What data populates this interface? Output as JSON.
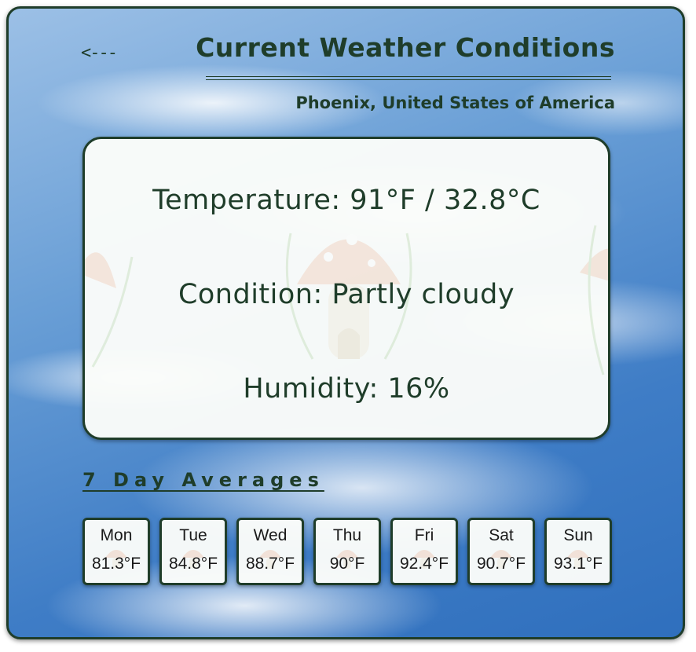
{
  "header": {
    "back_label": "<---",
    "title": "Current Weather Conditions",
    "location": "Phoenix, United States of America"
  },
  "current": {
    "temperature_line": "Temperature: 91°F / 32.8°C",
    "condition_line": "Condition: Partly cloudy",
    "humidity_line": "Humidity: 16%"
  },
  "forecast": {
    "heading": "7 Day Averages",
    "days": [
      {
        "day": "Mon",
        "temp": "81.3°F"
      },
      {
        "day": "Tue",
        "temp": "84.8°F"
      },
      {
        "day": "Wed",
        "temp": "88.7°F"
      },
      {
        "day": "Thu",
        "temp": "90°F"
      },
      {
        "day": "Fri",
        "temp": "92.4°F"
      },
      {
        "day": "Sat",
        "temp": "90.7°F"
      },
      {
        "day": "Sun",
        "temp": "93.1°F"
      }
    ]
  },
  "colors": {
    "accent": "#1f3d2a",
    "card_background": "#fcfdfa",
    "sky": "#3f7dc6"
  },
  "icons": {
    "back": "back-arrow-icon",
    "watermark": "mushroom-house-watermark-icon"
  }
}
